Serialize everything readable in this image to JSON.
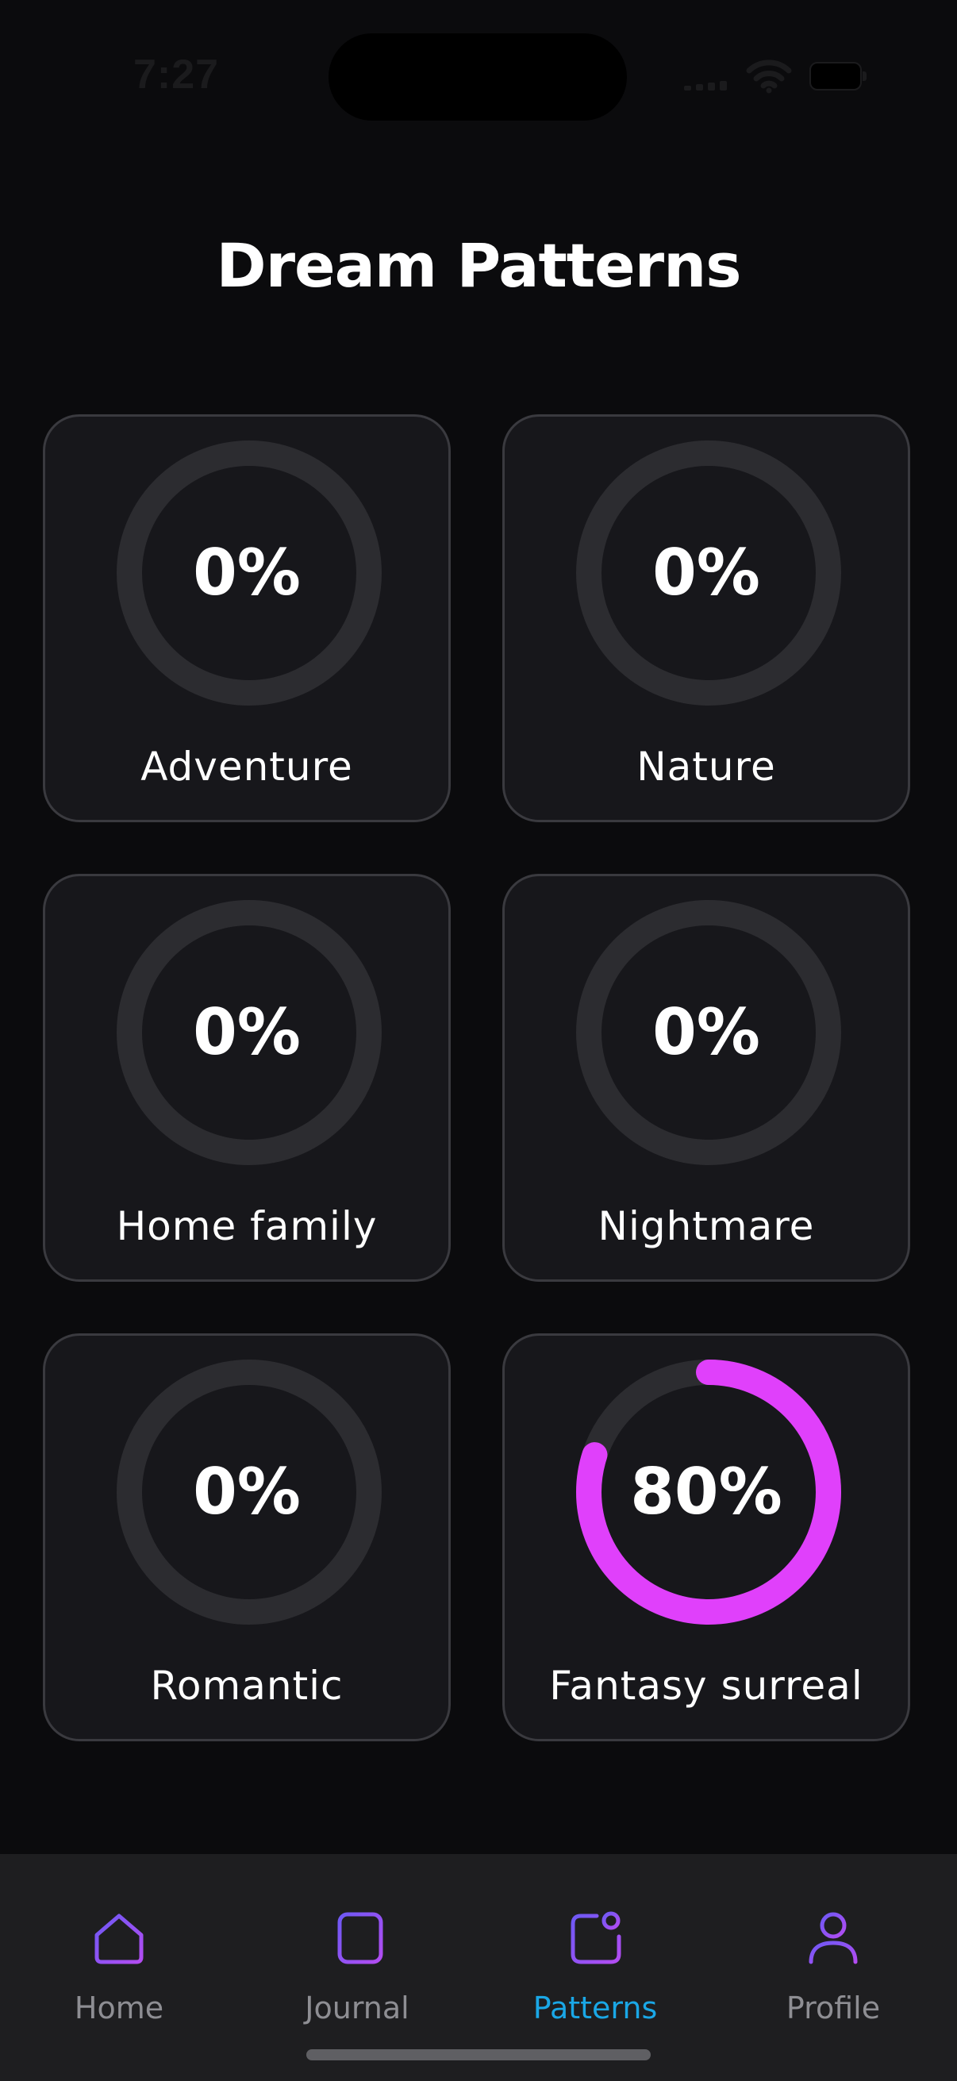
{
  "status_bar": {
    "time": "7:27"
  },
  "page": {
    "title": "Dream Patterns"
  },
  "colors": {
    "ring_track": "#2c2c30",
    "ring_progress": "#e040fb",
    "active_tab": "#1aa7e6",
    "icon_gradient_start": "#6e59f5",
    "icon_gradient_end": "#b34cf2"
  },
  "patterns": [
    {
      "label": "Adventure",
      "value_text": "0%",
      "progress": 0.0
    },
    {
      "label": "Nature",
      "value_text": "0%",
      "progress": 0.0
    },
    {
      "label": "Home family",
      "value_text": "0%",
      "progress": 0.0
    },
    {
      "label": "Nightmare",
      "value_text": "0%",
      "progress": 0.0
    },
    {
      "label": "Romantic",
      "value_text": "0%",
      "progress": 0.0
    },
    {
      "label": "Fantasy surreal",
      "value_text": "80%",
      "progress": 0.8
    }
  ],
  "tab_bar": {
    "tabs": [
      {
        "label": "Home",
        "icon": "home-icon",
        "active": false
      },
      {
        "label": "Journal",
        "icon": "journal-icon",
        "active": false
      },
      {
        "label": "Patterns",
        "icon": "patterns-icon",
        "active": true
      },
      {
        "label": "Profile",
        "icon": "profile-icon",
        "active": false
      }
    ]
  }
}
